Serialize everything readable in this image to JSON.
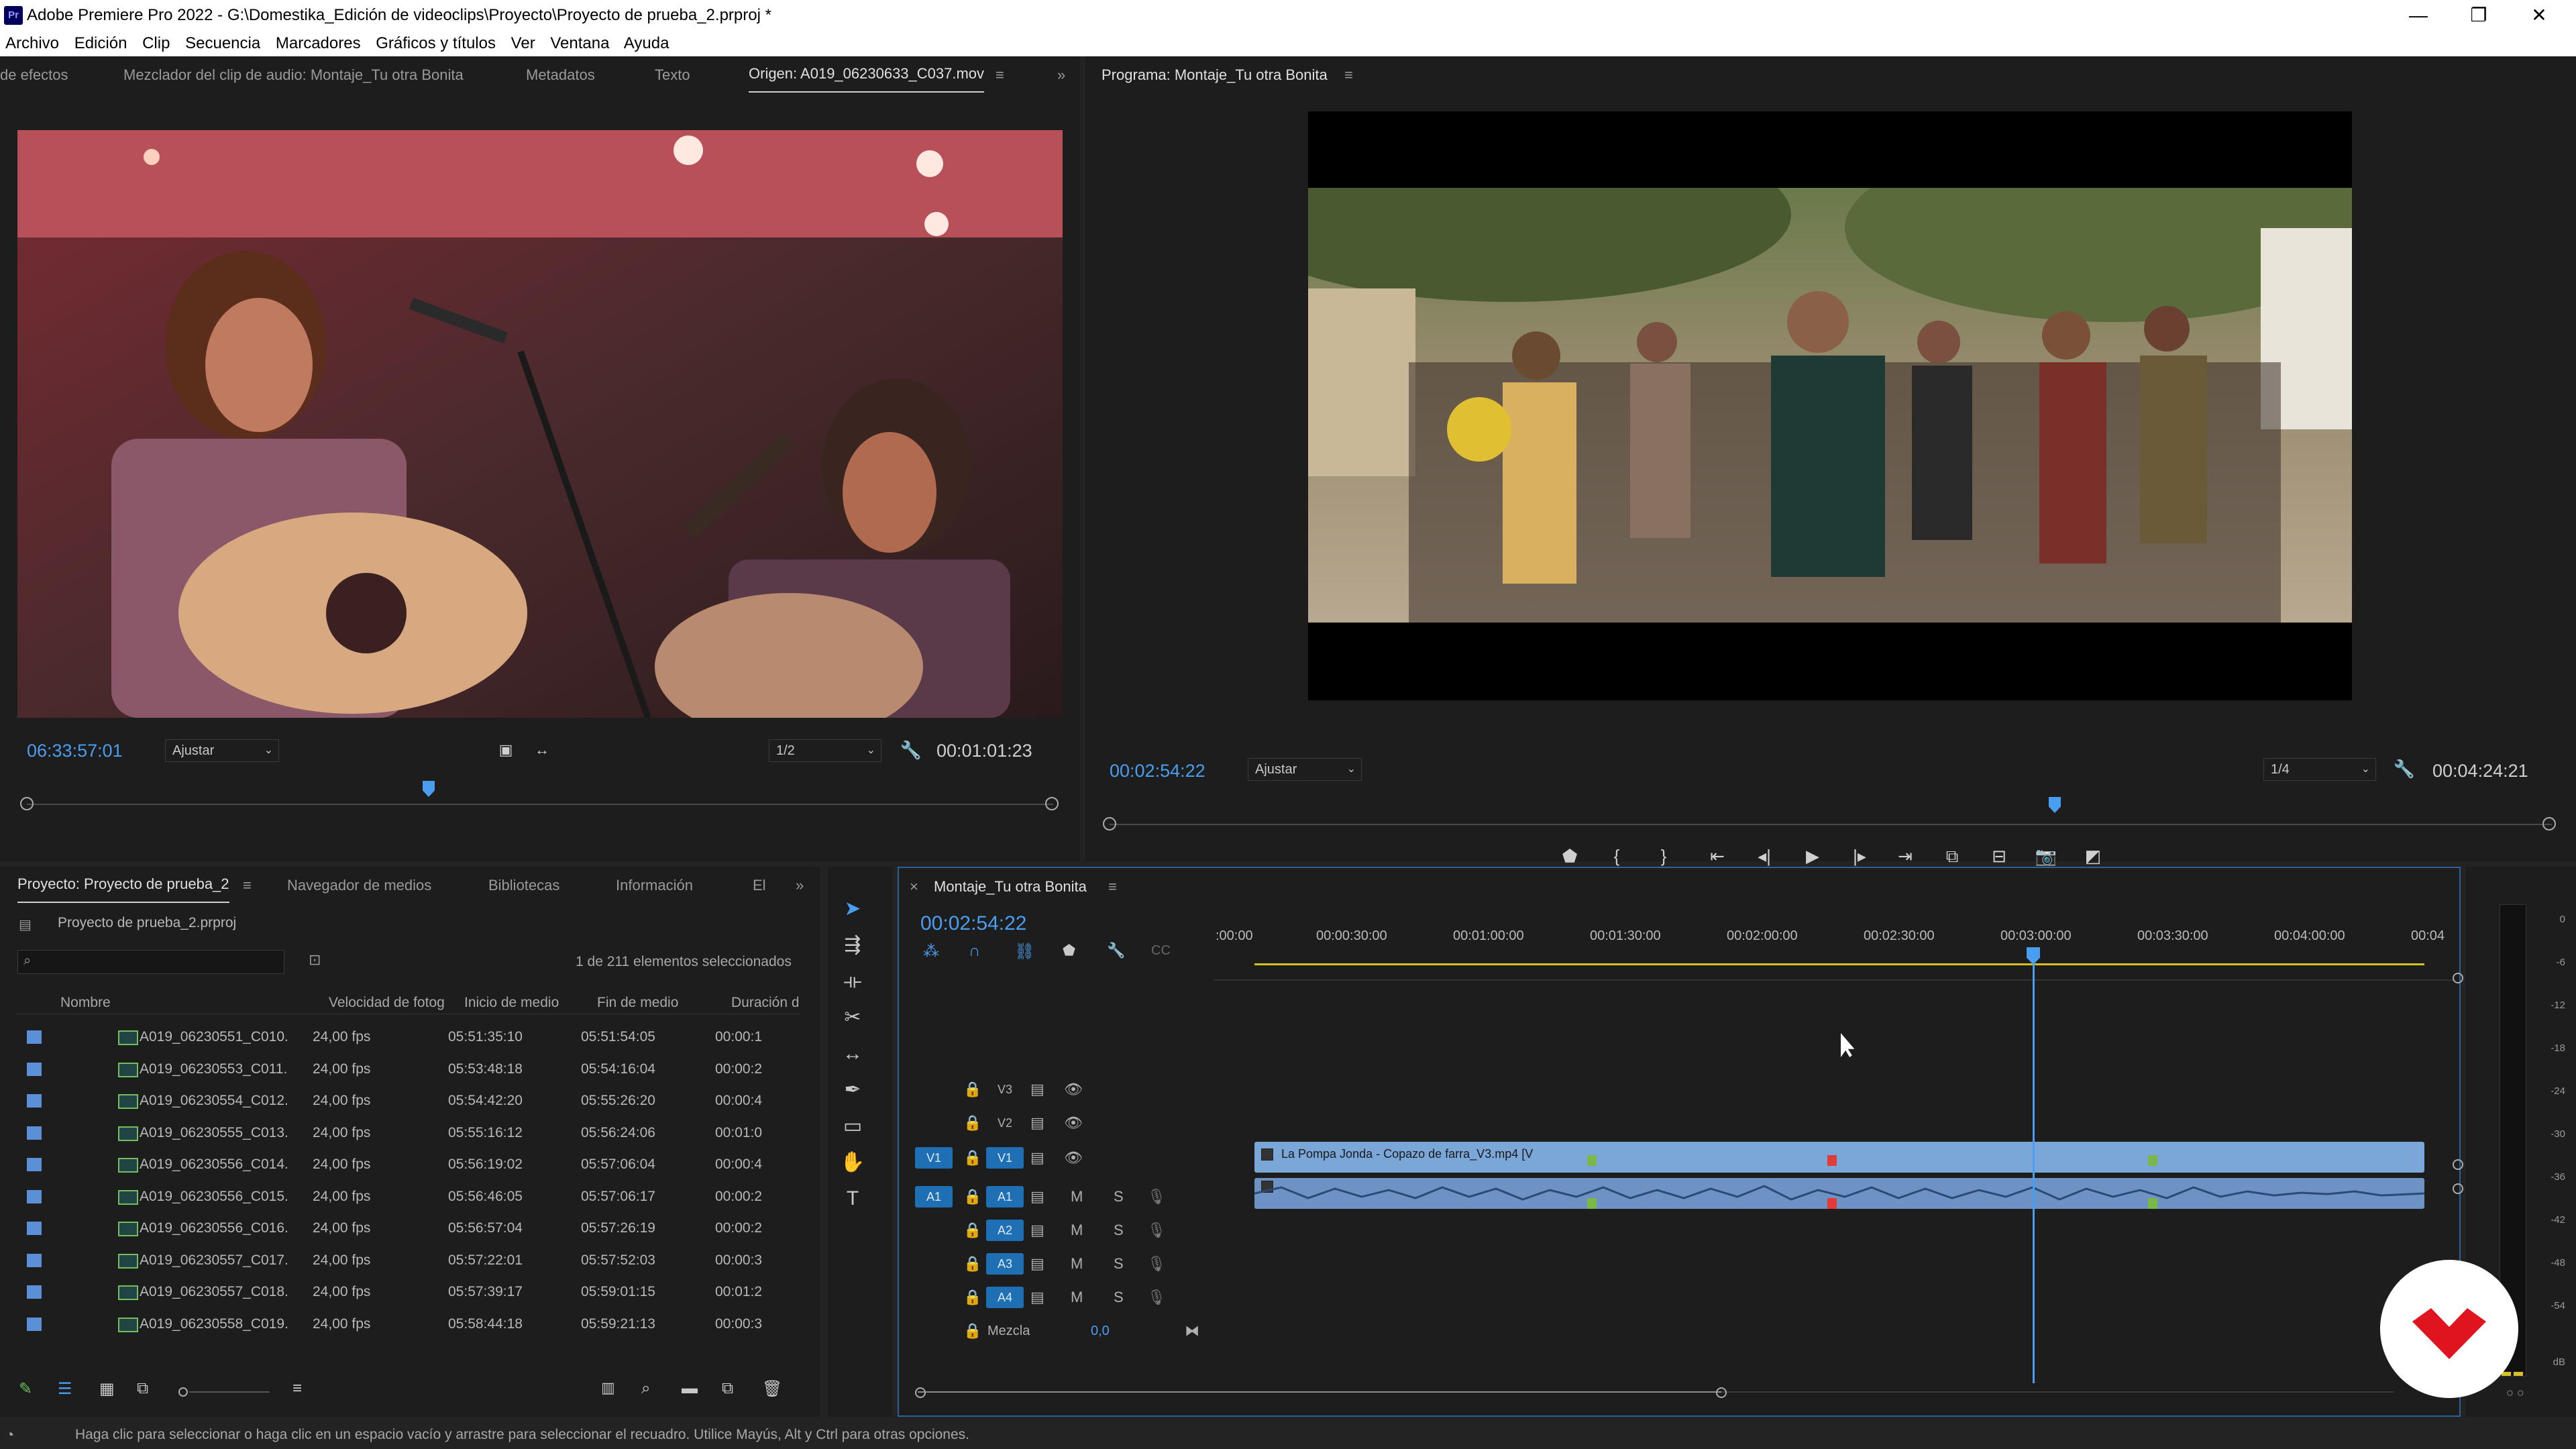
{
  "window": {
    "title": "Adobe Premiere Pro 2022 - G:\\Domestika_Edición de videoclips\\Proyecto\\Proyecto de prueba_2.prproj *",
    "logo": "Pr",
    "minimize": "—",
    "restore": "❐",
    "close": "✕"
  },
  "menu": [
    "Archivo",
    "Edición",
    "Clip",
    "Secuencia",
    "Marcadores",
    "Gráficos y títulos",
    "Ver",
    "Ventana",
    "Ayuda"
  ],
  "source_panel": {
    "tabs": [
      "de efectos",
      "Mezclador del clip de audio: Montaje_Tu otra Bonita",
      "Metadatos",
      "Texto",
      "Origen: A019_06230633_C037.mov"
    ],
    "tab_menu": "≡",
    "overflow": "»",
    "timecode_in": "06:33:57:01",
    "zoom": "Ajustar",
    "resolution": "1/2",
    "duration": "00:01:01:23"
  },
  "program_panel": {
    "tab": "Programa: Montaje_Tu otra Bonita",
    "tab_menu": "≡",
    "timecode": "00:02:54:22",
    "zoom": "Ajustar",
    "resolution": "1/4",
    "duration": "00:04:24:21"
  },
  "project_panel": {
    "tabs": [
      "Proyecto: Proyecto de prueba_2",
      "Navegador de medios",
      "Bibliotecas",
      "Información",
      "El"
    ],
    "tab_menu": "≡",
    "overflow": "»",
    "project_file": "Proyecto de prueba_2.prproj",
    "selection_info": "1 de 211 elementos seleccionados",
    "search_placeholder": "",
    "columns": [
      "Nombre",
      "Velocidad de fotog",
      "Inicio de medio",
      "Fin de medio",
      "Duración d"
    ],
    "rows": [
      {
        "name": "A019_06230551_C010.",
        "fps": "24,00 fps",
        "start": "05:51:35:10",
        "end": "05:51:54:05",
        "dur": "00:00:1"
      },
      {
        "name": "A019_06230553_C011.",
        "fps": "24,00 fps",
        "start": "05:53:48:18",
        "end": "05:54:16:04",
        "dur": "00:00:2"
      },
      {
        "name": "A019_06230554_C012.",
        "fps": "24,00 fps",
        "start": "05:54:42:20",
        "end": "05:55:26:20",
        "dur": "00:00:4"
      },
      {
        "name": "A019_06230555_C013.",
        "fps": "24,00 fps",
        "start": "05:55:16:12",
        "end": "05:56:24:06",
        "dur": "00:01:0"
      },
      {
        "name": "A019_06230556_C014.",
        "fps": "24,00 fps",
        "start": "05:56:19:02",
        "end": "05:57:06:04",
        "dur": "00:00:4"
      },
      {
        "name": "A019_06230556_C015.",
        "fps": "24,00 fps",
        "start": "05:56:46:05",
        "end": "05:57:06:17",
        "dur": "00:00:2"
      },
      {
        "name": "A019_06230556_C016.",
        "fps": "24,00 fps",
        "start": "05:56:57:04",
        "end": "05:57:26:19",
        "dur": "00:00:2"
      },
      {
        "name": "A019_06230557_C017.",
        "fps": "24,00 fps",
        "start": "05:57:22:01",
        "end": "05:57:52:03",
        "dur": "00:00:3"
      },
      {
        "name": "A019_06230557_C018.",
        "fps": "24,00 fps",
        "start": "05:57:39:17",
        "end": "05:59:01:15",
        "dur": "00:01:2"
      },
      {
        "name": "A019_06230558_C019.",
        "fps": "24,00 fps",
        "start": "05:58:44:18",
        "end": "05:59:21:13",
        "dur": "00:00:3"
      }
    ]
  },
  "timeline": {
    "tab": "Montaje_Tu otra Bonita",
    "close": "×",
    "tab_menu": "≡",
    "timecode": "00:02:54:22",
    "ticks": [
      ":00:00",
      "00:00:30:00",
      "00:01:00:00",
      "00:01:30:00",
      "00:02:00:00",
      "00:02:30:00",
      "00:03:00:00",
      "00:03:30:00",
      "00:04:00:00",
      "00:04"
    ],
    "video_tracks": [
      "V3",
      "V2",
      "V1"
    ],
    "audio_tracks": [
      "A1",
      "A2",
      "A3",
      "A4"
    ],
    "source_v": "V1",
    "source_a": "A1",
    "mute": "M",
    "solo": "S",
    "mix_label": "Mezcla",
    "mix_value": "0,0",
    "clip_name": "La Pompa Jonda - Copazo de farra_V3.mp4 [V",
    "playhead_fraction": 0.66
  },
  "meter": {
    "labels": [
      "0",
      "-6",
      "-12",
      "-18",
      "-24",
      "-30",
      "-36",
      "-42",
      "-48",
      "-54",
      "dB"
    ]
  },
  "status_bar": {
    "text": "Haga clic para seleccionar o haga clic en un espacio vacío y arrastre para seleccionar el recuadro. Utilice Mayús, Alt y Ctrl para otras opciones."
  },
  "colors": {
    "accent_blue": "#4a9ef0",
    "clip_video": "#7aa6d8",
    "clip_audio": "#6d93c4",
    "brand_red": "#e0141e",
    "marker_green": "#7ab648",
    "marker_red": "#e23b3b"
  }
}
